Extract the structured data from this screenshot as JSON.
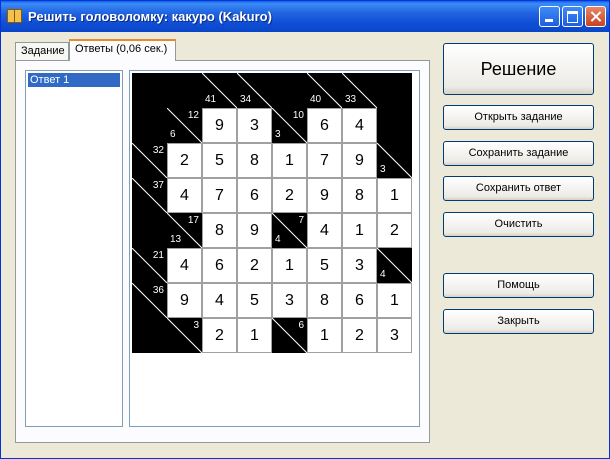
{
  "window": {
    "title": "Решить головоломку: какуро (Kakuro)"
  },
  "tabs": [
    {
      "label": "Задание"
    },
    {
      "label": "Ответы (0,06 сек.)"
    }
  ],
  "answers_list": {
    "items": [
      "Ответ 1"
    ]
  },
  "buttons": {
    "solve": "Решение",
    "open_task": "Открыть задание",
    "save_task": "Сохранить задание",
    "save_answer": "Сохранить ответ",
    "clear": "Очистить",
    "help": "Помощь",
    "close": "Закрыть"
  },
  "colors": {
    "title_bar": "#1f62e0",
    "selection": "#316ac5",
    "black_cell": "#000000"
  },
  "kakuro": {
    "rows": [
      [
        {
          "t": "b"
        },
        {
          "t": "b"
        },
        {
          "t": "c",
          "d": "41"
        },
        {
          "t": "c",
          "d": "34"
        },
        {
          "t": "b"
        },
        {
          "t": "c",
          "d": "40"
        },
        {
          "t": "c",
          "d": "33"
        },
        {
          "t": "b"
        }
      ],
      [
        {
          "t": "b"
        },
        {
          "t": "c",
          "r": "12",
          "d": "6"
        },
        {
          "t": "w",
          "v": "9"
        },
        {
          "t": "w",
          "v": "3"
        },
        {
          "t": "c",
          "r": "10",
          "d": "3"
        },
        {
          "t": "w",
          "v": "6"
        },
        {
          "t": "w",
          "v": "4"
        },
        {
          "t": "b"
        }
      ],
      [
        {
          "t": "c",
          "r": "32"
        },
        {
          "t": "w",
          "v": "2"
        },
        {
          "t": "w",
          "v": "5"
        },
        {
          "t": "w",
          "v": "8"
        },
        {
          "t": "w",
          "v": "1"
        },
        {
          "t": "w",
          "v": "7"
        },
        {
          "t": "w",
          "v": "9"
        },
        {
          "t": "c",
          "d": "3"
        }
      ],
      [
        {
          "t": "c",
          "r": "37"
        },
        {
          "t": "w",
          "v": "4"
        },
        {
          "t": "w",
          "v": "7"
        },
        {
          "t": "w",
          "v": "6"
        },
        {
          "t": "w",
          "v": "2"
        },
        {
          "t": "w",
          "v": "9"
        },
        {
          "t": "w",
          "v": "8"
        },
        {
          "t": "w",
          "v": "1"
        }
      ],
      [
        {
          "t": "b"
        },
        {
          "t": "c",
          "r": "17",
          "d": "13"
        },
        {
          "t": "w",
          "v": "8"
        },
        {
          "t": "w",
          "v": "9"
        },
        {
          "t": "c",
          "r": "7",
          "d": "4"
        },
        {
          "t": "w",
          "v": "4"
        },
        {
          "t": "w",
          "v": "1"
        },
        {
          "t": "w",
          "v": "2"
        }
      ],
      [
        {
          "t": "c",
          "r": "21"
        },
        {
          "t": "w",
          "v": "4"
        },
        {
          "t": "w",
          "v": "6"
        },
        {
          "t": "w",
          "v": "2"
        },
        {
          "t": "w",
          "v": "1"
        },
        {
          "t": "w",
          "v": "5"
        },
        {
          "t": "w",
          "v": "3"
        },
        {
          "t": "c",
          "d": "4"
        }
      ],
      [
        {
          "t": "c",
          "r": "36"
        },
        {
          "t": "w",
          "v": "9"
        },
        {
          "t": "w",
          "v": "4"
        },
        {
          "t": "w",
          "v": "5"
        },
        {
          "t": "w",
          "v": "3"
        },
        {
          "t": "w",
          "v": "8"
        },
        {
          "t": "w",
          "v": "6"
        },
        {
          "t": "w",
          "v": "1"
        }
      ],
      [
        {
          "t": "b"
        },
        {
          "t": "c",
          "r": "3"
        },
        {
          "t": "w",
          "v": "2"
        },
        {
          "t": "w",
          "v": "1"
        },
        {
          "t": "c",
          "r": "6"
        },
        {
          "t": "w",
          "v": "1"
        },
        {
          "t": "w",
          "v": "2"
        },
        {
          "t": "w",
          "v": "3"
        }
      ]
    ]
  }
}
